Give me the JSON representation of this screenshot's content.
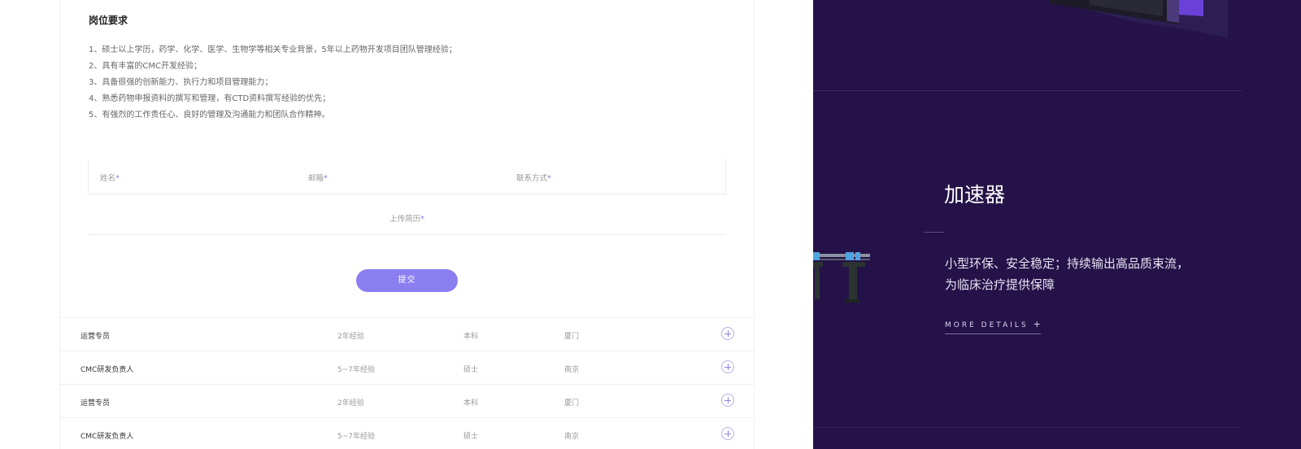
{
  "requirements": {
    "title": "岗位要求",
    "items": [
      "1、硕士以上学历，药学、化学、医学、生物学等相关专业背景，5年以上药物开发项目团队管理经验；",
      "2、具有丰富的CMC开发经验；",
      "3、具备很强的创新能力、执行力和项目管理能力；",
      "4、熟悉药物申报资料的撰写和管理，有CTD资料撰写经验的优先；",
      "5、有强烈的工作责任心、良好的管理及沟通能力和团队合作精神。"
    ]
  },
  "form": {
    "name_label": "姓名",
    "email_label": "邮箱",
    "contact_label": "联系方式",
    "upload_label": "上传简历",
    "required_mark": "*",
    "submit_label": "提交"
  },
  "jobs": [
    {
      "title": "运营专员",
      "experience": "2年经验",
      "education": "本科",
      "city": "厦门"
    },
    {
      "title": "CMC研发负责人",
      "experience": "5~7年经验",
      "education": "硕士",
      "city": "南京"
    },
    {
      "title": "运营专员",
      "experience": "2年经验",
      "education": "本科",
      "city": "厦门"
    },
    {
      "title": "CMC研发负责人",
      "experience": "5~7年经验",
      "education": "硕士",
      "city": "南京"
    }
  ],
  "product": {
    "title": "加速器",
    "desc_line1": "小型环保、安全稳定；持续输出高品质束流，",
    "desc_line2": "为临床治疗提供保障",
    "more_label": "MORE DETAILS",
    "more_plus": "+"
  },
  "colors": {
    "accent": "#8b7ef1",
    "panel_bg": "#241248"
  }
}
